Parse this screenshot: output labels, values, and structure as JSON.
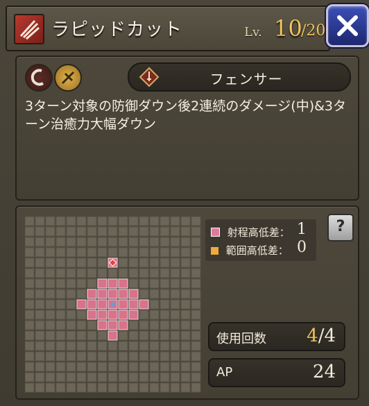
{
  "header": {
    "title": "ラピッドカット",
    "level_label": "Lv.",
    "level_current": "10",
    "level_max": "/20",
    "skill_icon": "slash-claw-icon",
    "close_icon": "close-x-icon"
  },
  "attributes": {
    "icon1": "sickle-slash-icon",
    "icon2": "gold-blade-icon"
  },
  "class_pill": {
    "icon": "fencer-class-icon",
    "name": "フェンサー"
  },
  "description": "3ターン対象の防御ダウン後2連続のダメージ(中)&3ターン治癒力大幅ダウン",
  "range": {
    "legend": [
      {
        "label": "射程高低差：",
        "value": "1",
        "color": "#e07a9a"
      },
      {
        "label": "範囲高低差：",
        "value": "0",
        "color": "#f0a93c"
      }
    ],
    "help_label": "?"
  },
  "stats": {
    "uses_label": "使用回数",
    "uses_current": "4",
    "uses_max": "/4",
    "ap_label": "AP",
    "ap_value": "24"
  },
  "colors": {
    "accent_gold": "#f0c35a",
    "range_tile": "#d9728b",
    "target_marker": "#e0453a",
    "center_marker": "#4aa8f0"
  }
}
